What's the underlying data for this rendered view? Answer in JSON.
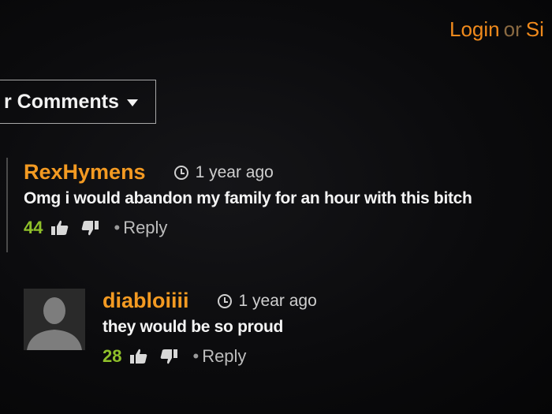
{
  "header": {
    "login_label": "Login",
    "or_label": "or",
    "signup_label": "Si"
  },
  "sort": {
    "label": "r Comments"
  },
  "comments": [
    {
      "username": "RexHymens",
      "time": "1 year ago",
      "text": "Omg i would abandon my family for an hour with this bitch",
      "likes": "44",
      "reply_label": "Reply",
      "bullet": "•"
    },
    {
      "username": "diabloiiii",
      "time": "1 year ago",
      "text": "they would be so proud",
      "likes": "28",
      "reply_label": "Reply",
      "bullet": "•"
    }
  ],
  "icons": {
    "clock": "clock-icon",
    "thumbs_up": "thumbs-up-icon",
    "thumbs_down": "thumbs-down-icon",
    "avatar": "default-avatar-silhouette"
  },
  "colors": {
    "accent": "#f08a1c",
    "username": "#f39a22",
    "likes": "#8fc02a",
    "background": "#0b0b0d"
  }
}
